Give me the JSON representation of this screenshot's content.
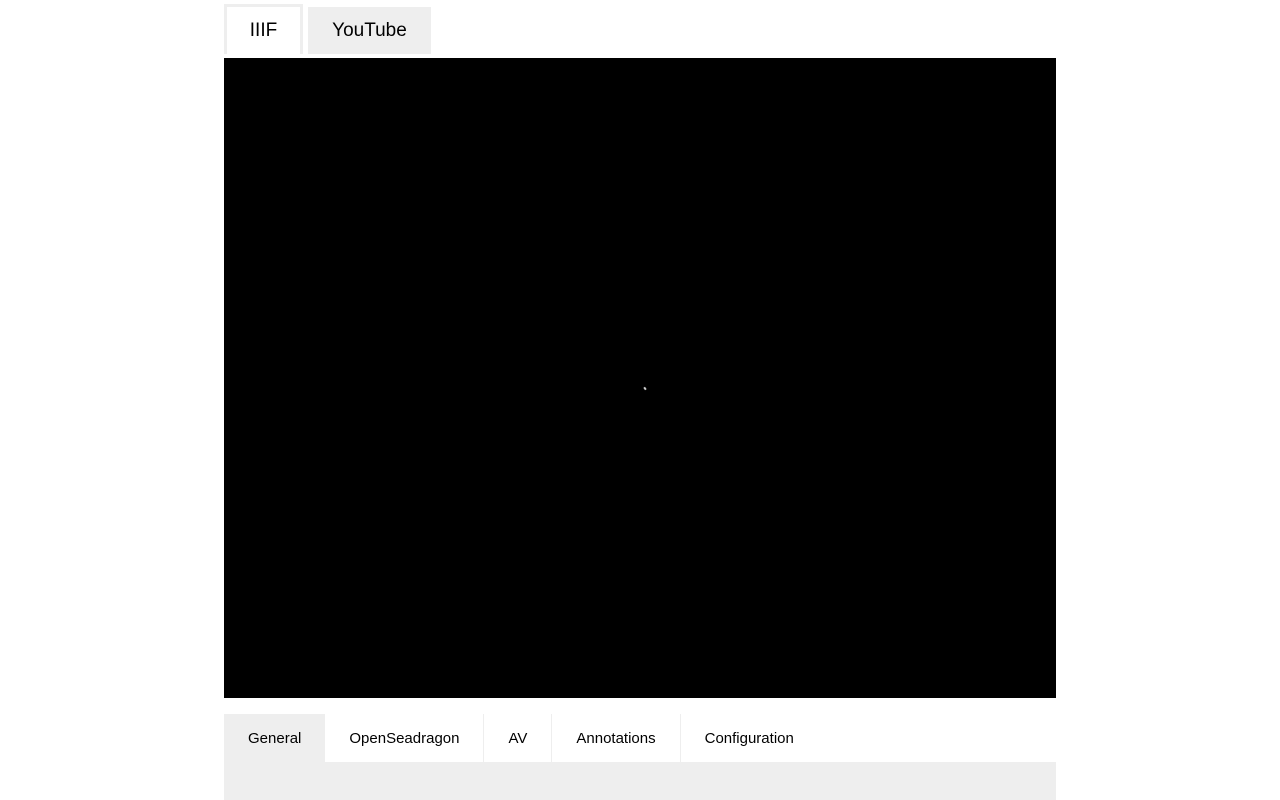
{
  "source_tabs": [
    {
      "label": "IIIF",
      "active": true
    },
    {
      "label": "YouTube",
      "active": false
    }
  ],
  "viewer": {
    "background": "#000000",
    "spinner_icon": "loading-spinner-icon"
  },
  "bottom_tabs": [
    {
      "label": "General",
      "active": true
    },
    {
      "label": "OpenSeadragon",
      "active": false
    },
    {
      "label": "AV",
      "active": false
    },
    {
      "label": "Annotations",
      "active": false
    },
    {
      "label": "Configuration",
      "active": false
    }
  ],
  "colors": {
    "tab_inactive_bg": "#eeeeee",
    "panel_bg": "#eeeeee"
  }
}
